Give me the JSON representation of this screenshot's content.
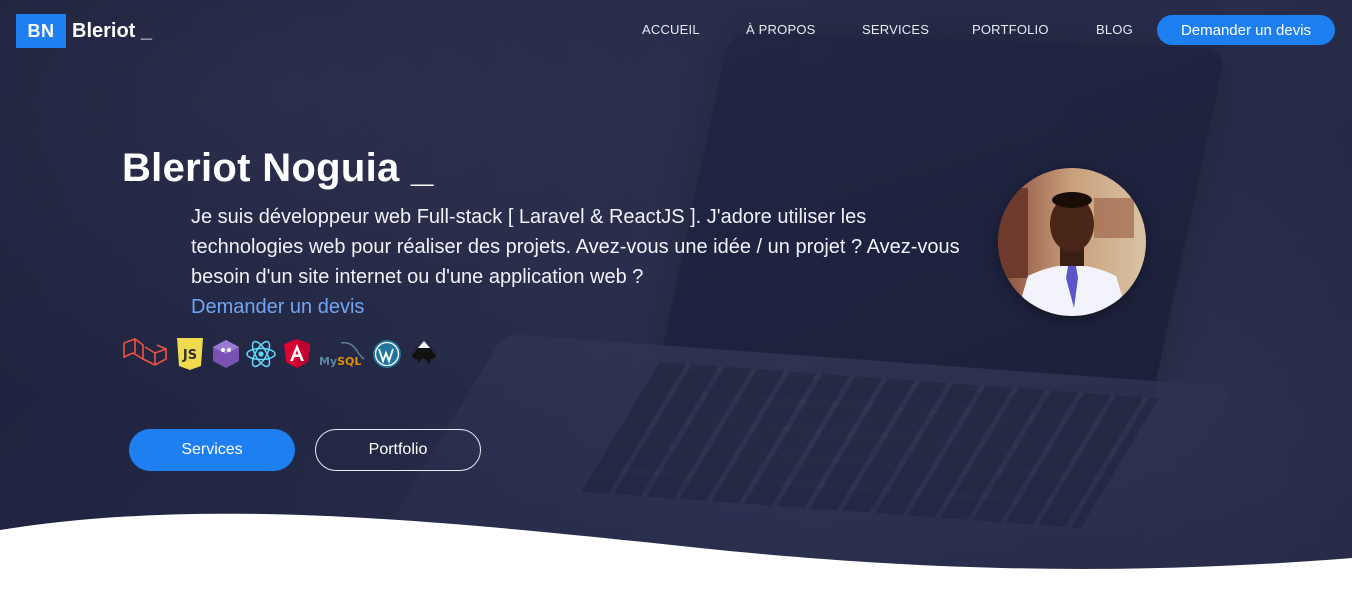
{
  "brand": {
    "logo_initials": "BN",
    "logo_name": "Bleriot _"
  },
  "nav": {
    "items": [
      {
        "label": "ACCUEIL"
      },
      {
        "label": "À PROPOS"
      },
      {
        "label": "SERVICES"
      },
      {
        "label": "PORTFOLIO"
      },
      {
        "label": "BLOG"
      }
    ],
    "cta_label": "Demander un devis"
  },
  "hero": {
    "title": "Bleriot Noguia _",
    "intro": "Je suis développeur web Full-stack [ Laravel & ReactJS ]. J'adore utiliser les technologies web pour réaliser des projets. Avez-vous une idée / un projet ? Avez-vous besoin d'un site internet ou d'une application web ?",
    "intro_link": "Demander un devis",
    "buttons": {
      "primary": "Services",
      "secondary": "Portfolio"
    }
  },
  "tech_icons": [
    {
      "name": "laravel-icon",
      "color": "#f05340"
    },
    {
      "name": "javascript-icon",
      "color": "#f0db4f",
      "text": "JS"
    },
    {
      "name": "bootstrap-icon",
      "color": "#7952b3"
    },
    {
      "name": "react-icon",
      "color": "#61dafb"
    },
    {
      "name": "angular-icon",
      "color": "#dd0031"
    },
    {
      "name": "mysql-icon",
      "color": "#e48e00",
      "text": "MySQL"
    },
    {
      "name": "wordpress-icon",
      "color": "#21759b"
    },
    {
      "name": "inkscape-icon",
      "color": "#111111"
    }
  ],
  "colors": {
    "accent": "#1e7ff0",
    "link": "#6fa6f3",
    "background": "#262b48"
  }
}
